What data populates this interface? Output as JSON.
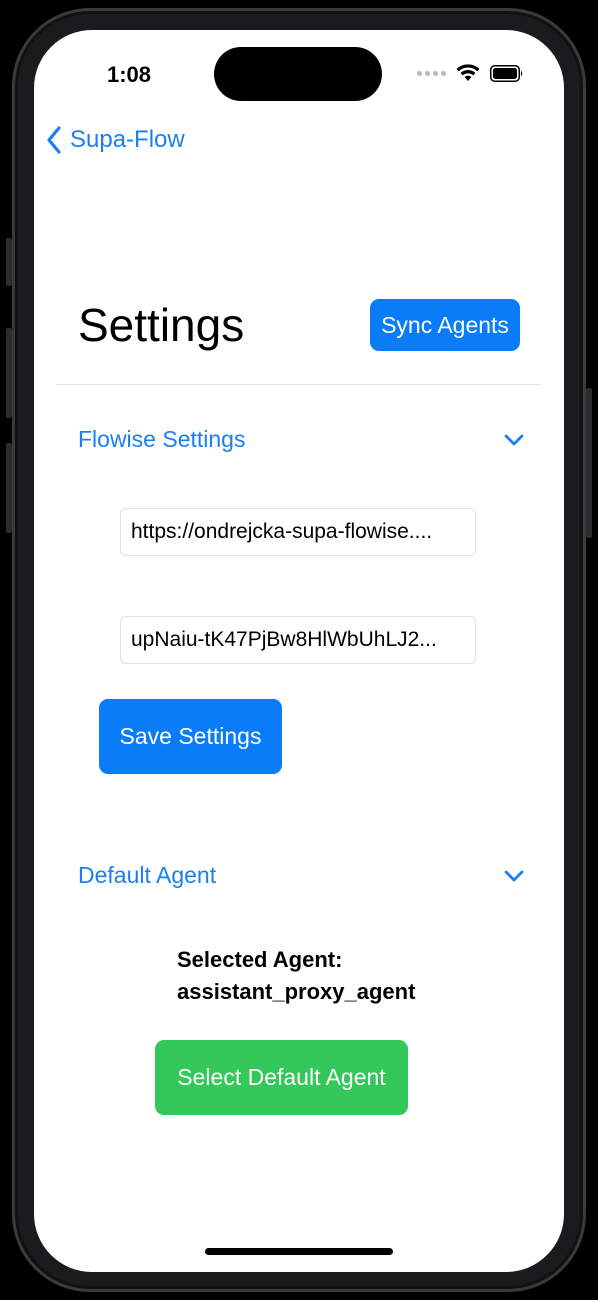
{
  "status_bar": {
    "time": "1:08"
  },
  "nav": {
    "back_label": "Supa-Flow"
  },
  "header": {
    "title": "Settings",
    "sync_label": "Sync Agents"
  },
  "flowise_section": {
    "title": "Flowise Settings",
    "url_value": "https://ondrejcka-supa-flowise....",
    "api_key_value": "upNaiu-tK47PjBw8HlWbUhLJ2...",
    "save_label": "Save Settings"
  },
  "agent_section": {
    "title": "Default Agent",
    "selected_prefix": "Selected Agent:",
    "selected_agent": "assistant_proxy_agent",
    "select_label": "Select Default Agent"
  },
  "colors": {
    "accent_blue": "#0a7cf7",
    "link_blue": "#1a7ff5",
    "success_green": "#34c759"
  }
}
